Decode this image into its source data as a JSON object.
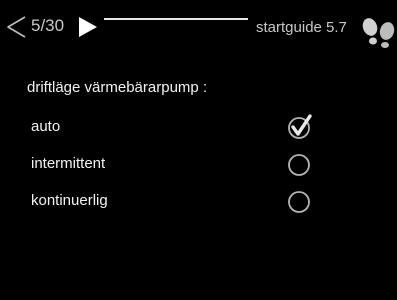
{
  "header": {
    "page_counter": "5/30",
    "section_title": "startguide 5.7",
    "icons": {
      "back": "chevron-left-outline-icon",
      "forward": "play-right-filled-icon",
      "help": "footprints-icon"
    }
  },
  "question": "driftläge värmebärarpump :",
  "options": [
    {
      "label": "auto",
      "selected": true
    },
    {
      "label": "intermittent",
      "selected": false
    },
    {
      "label": "kontinuerlig",
      "selected": false
    }
  ],
  "colors": {
    "background": "#000000",
    "text": "#f2f2f2",
    "muted_text": "#c8c8c8",
    "control": "#b4b4b4"
  }
}
